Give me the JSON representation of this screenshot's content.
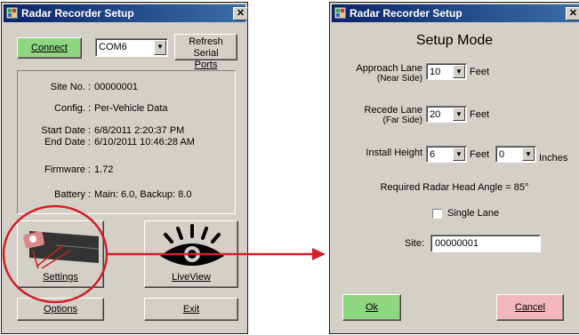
{
  "window1": {
    "title": "Radar Recorder Setup",
    "close_glyph": "✕",
    "connect_label": "Connect",
    "port": "COM6",
    "refresh_line1": "Refresh Serial",
    "refresh_line2": "Ports",
    "info": {
      "site_no_label": "Site No. :",
      "site_no": "00000001",
      "config_label": "Config. :",
      "config": "Per-Vehicle Data",
      "start_date_label": "Start Date :",
      "start_date": "6/8/2011 2:20:37 PM",
      "end_date_label": "End Date :",
      "end_date": "6/10/2011 10:46:28 AM",
      "firmware_label": "Firmware :",
      "firmware": "1.72",
      "battery_label": "Battery :",
      "battery": "Main: 6.0,  Backup: 8.0"
    },
    "settings_label": "Settings",
    "liveview_label": "LiveView",
    "options_label": "Options",
    "exit_label": "Exit"
  },
  "window2": {
    "title": "Radar Recorder Setup",
    "close_glyph": "✕",
    "heading": "Setup Mode",
    "approach_line1": "Approach Lane",
    "approach_line2": "(Near Side)",
    "approach_value": "10",
    "approach_unit": "Feet",
    "recede_line1": "Recede Lane",
    "recede_line2": "(Far Side)",
    "recede_value": "20",
    "recede_unit": "Feet",
    "install_label": "Install Height",
    "install_feet": "6",
    "install_feet_unit": "Feet",
    "install_inches": "0",
    "install_inches_unit": "Inches",
    "radar_angle": "Required Radar Head Angle = 85°",
    "single_lane_label": "Single Lane",
    "site_label": "Site:",
    "site_value": "00000001",
    "ok_label": "Ok",
    "cancel_label": "Cancel"
  },
  "colors": {
    "dialog_bg": "#d4d0c8",
    "title_bar": "#0a246a",
    "annotation_red": "#d12027",
    "connect_green": "#8fd680",
    "cancel_pink": "#f2b6bd"
  },
  "icons": {
    "window_icon": "app-icon",
    "settings_icon": "radar-sensor-icon",
    "liveview_icon": "eye-icon",
    "dropdown": "chevron-down-icon"
  }
}
